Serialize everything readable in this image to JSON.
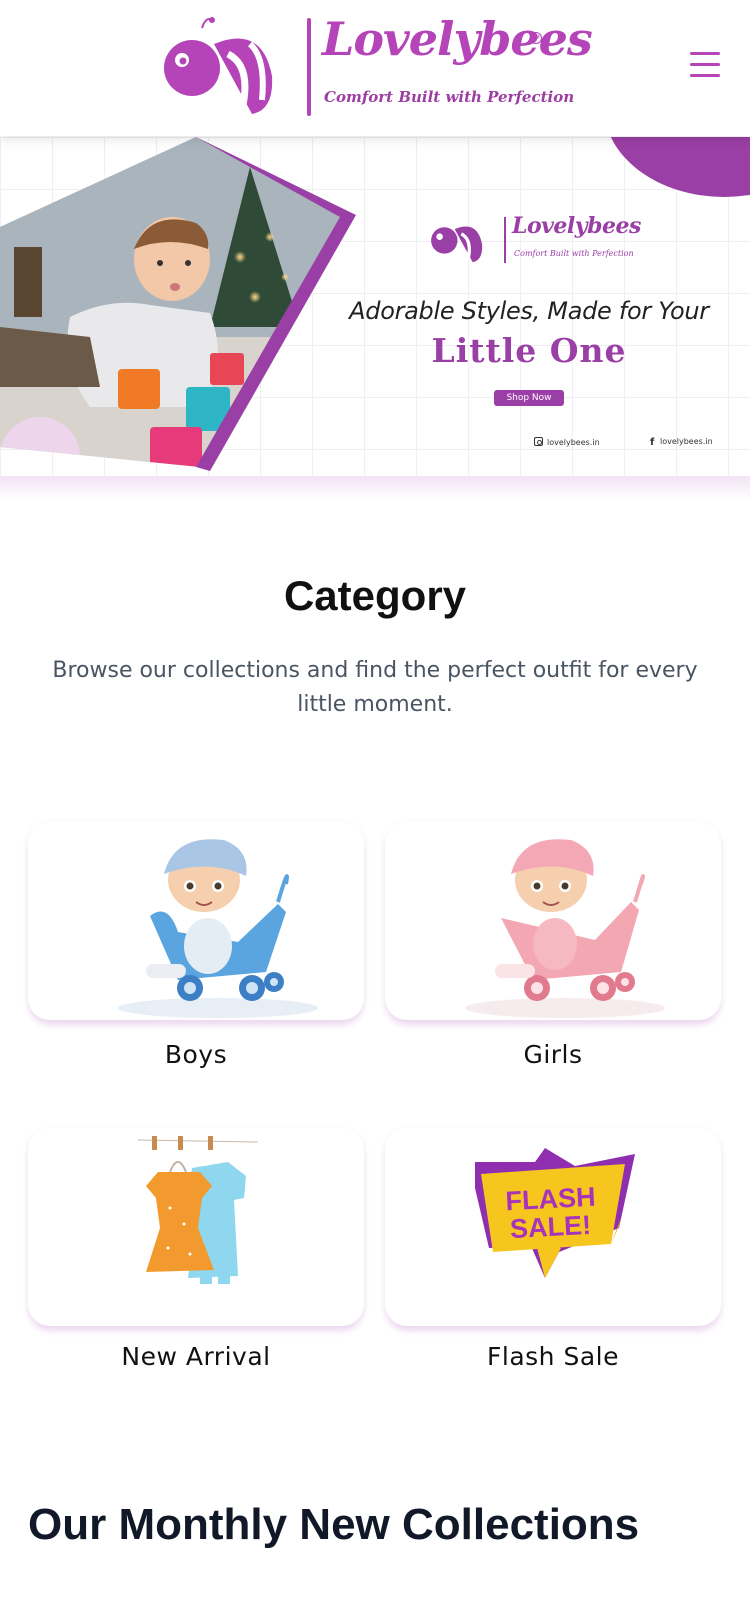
{
  "header": {
    "brand_name": "Lovelybees",
    "tm": "TM",
    "tagline": "Comfort Built with Perfection",
    "menu_icon": "hamburger-menu-icon",
    "brand_color": "#b444b8"
  },
  "banner": {
    "brand_name": "Lovelybees",
    "tagline": "Comfort Built with Perfection",
    "headline": "Adorable Styles, Made for Your",
    "subheadline": "Little One",
    "cta": "Shop Now",
    "instagram": "lovelybees.in",
    "facebook": "lovelybees.in",
    "accent_color": "#9a3fa5"
  },
  "category": {
    "title": "Category",
    "description": "Browse our collections and find the perfect outfit for every little moment.",
    "items": [
      {
        "label": "Boys",
        "image": "baby-boy-stroller"
      },
      {
        "label": "Girls",
        "image": "baby-girl-stroller"
      },
      {
        "label": "New Arrival",
        "image": "baby-clothes-hanger"
      },
      {
        "label": "Flash Sale",
        "image": "flash-sale-badge"
      }
    ],
    "flash_sale_badge": "FLASH SALE!"
  },
  "collections": {
    "title": "Our Monthly New Collections"
  }
}
